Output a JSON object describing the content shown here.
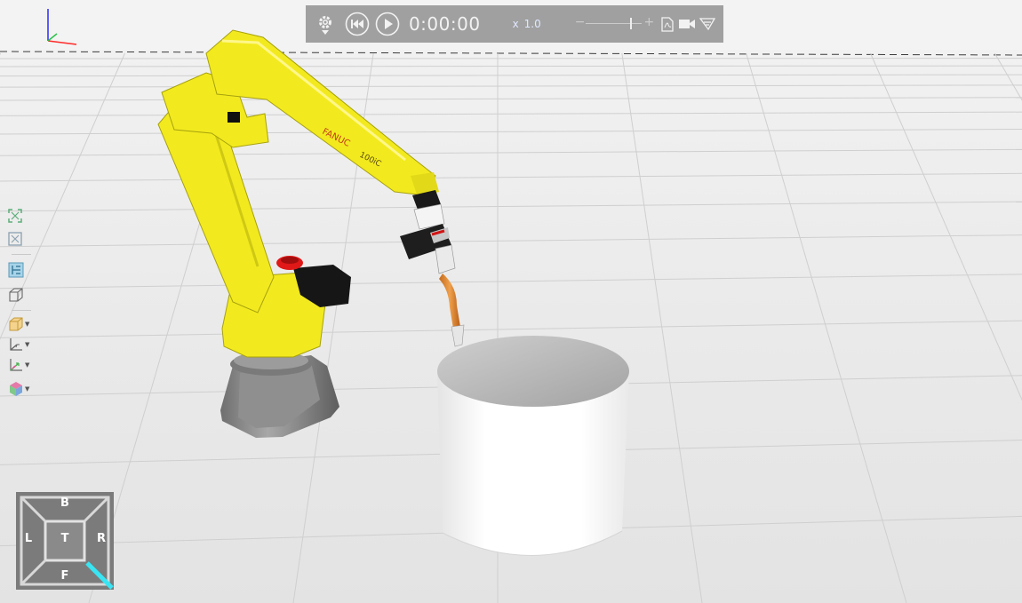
{
  "toolbar": {
    "time": "0:00:00",
    "speed_prefix": "x",
    "speed_value": "1.0",
    "speed_slider_fraction": 0.72,
    "icons": [
      "gear-icon",
      "rewind-icon",
      "play-icon",
      "pdf-export-icon",
      "video-record-icon",
      "toolpath-icon"
    ]
  },
  "side_tools": [
    {
      "name": "zoom-fit-icon"
    },
    {
      "name": "zoom-window-icon"
    },
    {
      "name": "section-view-icon"
    },
    {
      "name": "wireframe-box-icon"
    },
    {
      "name": "display-mode-icon"
    },
    {
      "name": "axis-frame-icon"
    },
    {
      "name": "grid-plane-icon"
    },
    {
      "name": "object-color-icon"
    }
  ],
  "nav_cube": {
    "top": "B",
    "left": "L",
    "center": "T",
    "right": "R",
    "bottom": "F",
    "highlight_color": "#39e5f3"
  },
  "scene": {
    "robot": "FANUC welding robot arm",
    "robot_label": "FANUC",
    "robot_model": "100iC",
    "robot_color": "#f2ea1e",
    "cylinder_color": "#f5f5f5",
    "floor_color": "#e8e8e8"
  }
}
